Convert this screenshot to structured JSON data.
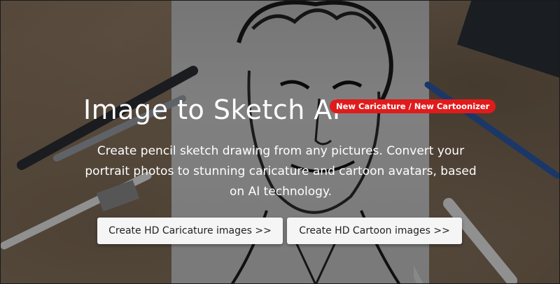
{
  "hero": {
    "title": "Image to Sketch AI",
    "badge": "New Caricature / New Cartoonizer",
    "description": "Create pencil sketch drawing from any pictures. Convert your portrait photos to stunning caricature and cartoon avatars, based on AI technology."
  },
  "buttons": {
    "caricature": "Create HD Caricature images >>",
    "cartoon": "Create HD Cartoon images >>"
  },
  "colors": {
    "badge": "#e01b1b",
    "button_bg": "#f5f5f5",
    "title": "#ffffff"
  }
}
